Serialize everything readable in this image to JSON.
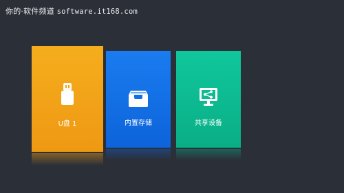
{
  "watermark": {
    "prefix": "你的",
    "brand": "·软件频道",
    "url": "software.it168.com"
  },
  "tiles": [
    {
      "label": "U盘 1",
      "icon": "usb-drive-icon",
      "color": "#f5a31a"
    },
    {
      "label": "内置存储",
      "icon": "internal-storage-icon",
      "color": "#1270e6"
    },
    {
      "label": "共享设备",
      "icon": "shared-device-icon",
      "color": "#0dbb91"
    }
  ]
}
